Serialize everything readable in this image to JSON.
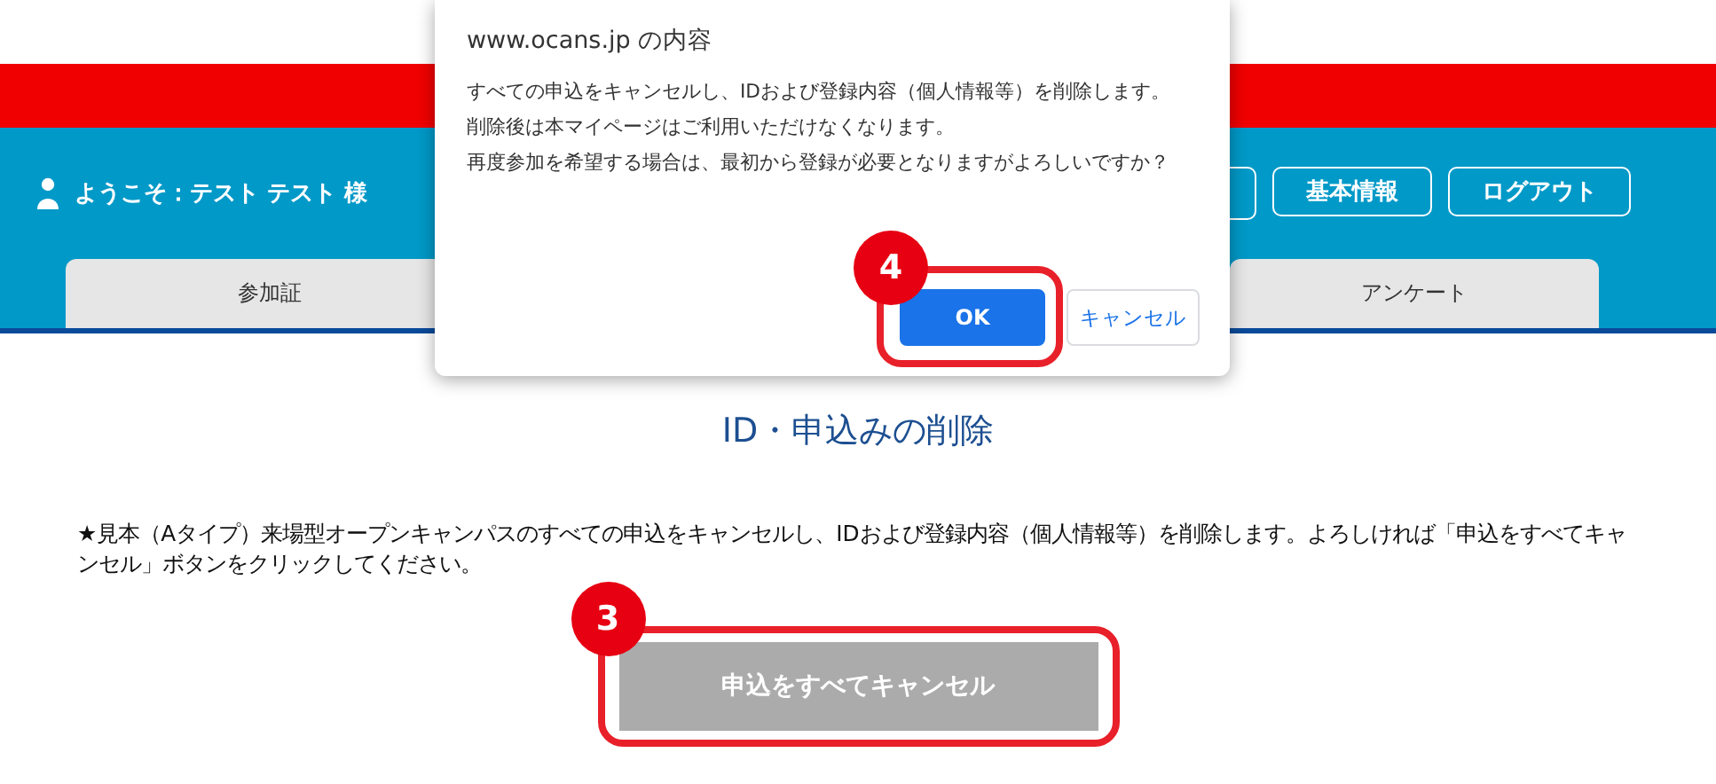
{
  "header": {
    "user": "ようこそ：テスト テスト 様",
    "buttons": [
      "基本情報",
      "ログアウト"
    ]
  },
  "tabs": [
    "参加証",
    "アンケート"
  ],
  "main": {
    "heading": "ID・申込みの削除",
    "notice": "★見本（Aタイプ）来場型オープンキャンパスのすべての申込をキャンセルし、IDおよび登録内容（個人情報等）を削除します。よろしければ「申込をすべてキャンセル」ボタンをクリックしてください。",
    "button": "申込をすべてキャンセル",
    "step": "3"
  },
  "dialog": {
    "title": "www.ocans.jp の内容",
    "lines": [
      "すべての申込をキャンセルし、IDおよび登録内容（個人情報等）を削除します。",
      "削除後は本マイページはご利用いただけなくなります。",
      "再度参加を希望する場合は、最初から登録が必要となりますがよろしいですか？"
    ],
    "ok": "OK",
    "cancel": "キャンセル",
    "step": "4"
  }
}
